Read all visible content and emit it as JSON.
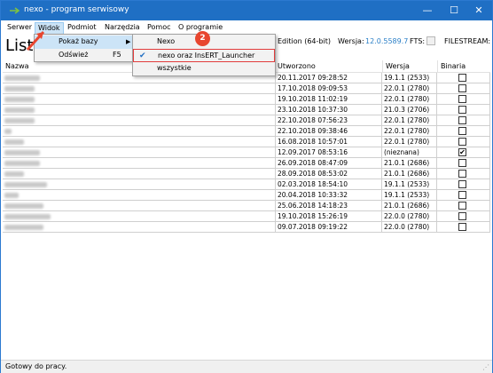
{
  "window": {
    "title": "nexo - program serwisowy",
    "min_glyph": "—",
    "max_glyph": "☐",
    "close_glyph": "✕"
  },
  "menubar": {
    "items": [
      "Serwer",
      "Widok",
      "Podmiot",
      "Narzędzia",
      "Pomoc",
      "O programie"
    ]
  },
  "header": {
    "big_title": "Lista",
    "edition": "Edition (64-bit)",
    "version_label": "Wersja:",
    "version_value": "12.0.5589.7",
    "fts_label": "FTS:",
    "filestream_label": "FILESTREAM:"
  },
  "table": {
    "columns": [
      "Nazwa",
      "Utworzono",
      "Wersja",
      "Binaria"
    ],
    "rows": [
      {
        "date": "20.11.2017 09:28:52",
        "version": "19.1.1 (2533)",
        "binaria": false,
        "w": 40
      },
      {
        "date": "17.10.2018 09:09:53",
        "version": "22.0.1 (2780)",
        "binaria": false,
        "w": 34
      },
      {
        "date": "19.10.2018 11:02:19",
        "version": "22.0.1 (2780)",
        "binaria": false,
        "w": 34
      },
      {
        "date": "23.10.2018 10:37:30",
        "version": "21.0.3 (2706)",
        "binaria": false,
        "w": 34
      },
      {
        "date": "22.10.2018 07:56:23",
        "version": "22.0.1 (2780)",
        "binaria": false,
        "w": 34
      },
      {
        "date": "22.10.2018 09:38:46",
        "version": "22.0.1 (2780)",
        "binaria": false,
        "w": 8
      },
      {
        "date": "16.08.2018 10:57:01",
        "version": "22.0.1 (2780)",
        "binaria": false,
        "w": 22
      },
      {
        "date": "12.09.2017 08:53:16",
        "version": "(nieznana)",
        "binaria": true,
        "w": 40
      },
      {
        "date": "26.09.2018 08:47:09",
        "version": "21.0.1 (2686)",
        "binaria": false,
        "w": 40
      },
      {
        "date": "28.09.2018 08:53:02",
        "version": "21.0.1 (2686)",
        "binaria": false,
        "w": 22
      },
      {
        "date": "02.03.2018 18:54:10",
        "version": "19.1.1 (2533)",
        "binaria": false,
        "w": 48
      },
      {
        "date": "20.04.2018 10:33:32",
        "version": "19.1.1 (2533)",
        "binaria": false,
        "w": 16
      },
      {
        "date": "25.06.2018 14:18:23",
        "version": "21.0.1 (2686)",
        "binaria": false,
        "w": 44
      },
      {
        "date": "19.10.2018 15:26:19",
        "version": "22.0.0 (2780)",
        "binaria": false,
        "w": 52
      },
      {
        "date": "09.07.2018 09:19:22",
        "version": "22.0.0 (2780)",
        "binaria": false,
        "w": 44
      }
    ]
  },
  "dropdown_widok": {
    "items": [
      {
        "label": "Pokaż bazy",
        "shortcut": "",
        "submenu": true
      },
      {
        "label": "Odśwież",
        "shortcut": "F5",
        "submenu": false
      }
    ]
  },
  "dropdown_pokaz_bazy": {
    "items": [
      {
        "label": "Nexo",
        "checked": false
      },
      {
        "label": "nexo oraz InsERT_Launcher",
        "checked": true
      },
      {
        "label": "wszystkie",
        "checked": false
      }
    ]
  },
  "annotation": {
    "badge_number": "2",
    "color": "#e8462f"
  },
  "status": {
    "text": "Gotowy do pracy."
  },
  "colors": {
    "titlebar": "#1f6fc4",
    "menu_highlight": "#cce4f7",
    "highlight_border": "#e23c3c",
    "version_blue": "#2a7fc7"
  }
}
